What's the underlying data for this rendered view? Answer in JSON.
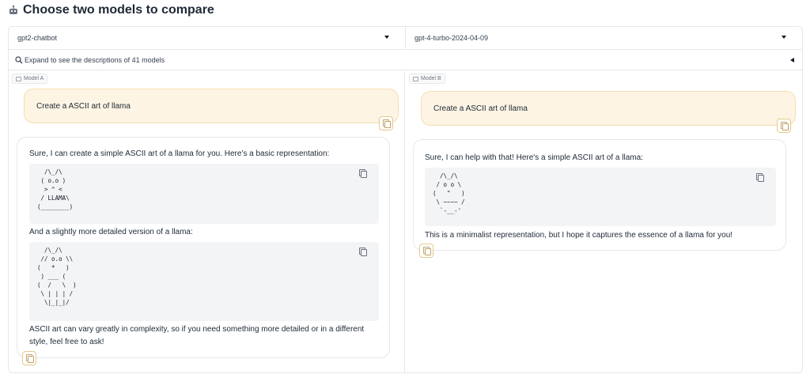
{
  "header": {
    "icon": "robot-icon",
    "title": "Choose two models to compare"
  },
  "selectors": {
    "model_a": "gpt2-chatbot",
    "model_b": "gpt-4-turbo-2024-04-09"
  },
  "expander": {
    "icon": "magnifier-icon",
    "label": "Expand to see the descriptions of 41 models"
  },
  "model_a": {
    "label": "Model A",
    "user_message": "Create a ASCII art of llama",
    "response": {
      "intro": "Sure, I can create a simple ASCII art of a llama for you. Here's a basic representation:",
      "code1": "  /\\_/\\\n ( o.o )\n  > ^ <\n / LLAMA\\\n(________)",
      "middle": "And a slightly more detailed version of a llama:",
      "code2": "  /\\_/\\\n // o.o \\\\\n(   *   )\n ) ___ (\n(  /   \\  )\n \\ | | | /\n  \\|_|_|/",
      "outro_line1": "ASCII art can vary greatly in complexity, so if you need something more detailed or in a different",
      "outro_line2": "style, feel free to ask!"
    }
  },
  "model_b": {
    "label": "Model B",
    "user_message": "Create a ASCII art of llama",
    "response": {
      "intro": "Sure, I can help with that! Here's a simple ASCII art of a llama:",
      "code1": "  /\\_/\\\n / o o \\\n(   \"   )\n \\ ~~~~ /\n  `-__-'",
      "outro": "This is a minimalist representation, but I hope it captures the essence of a llama for you!"
    }
  }
}
